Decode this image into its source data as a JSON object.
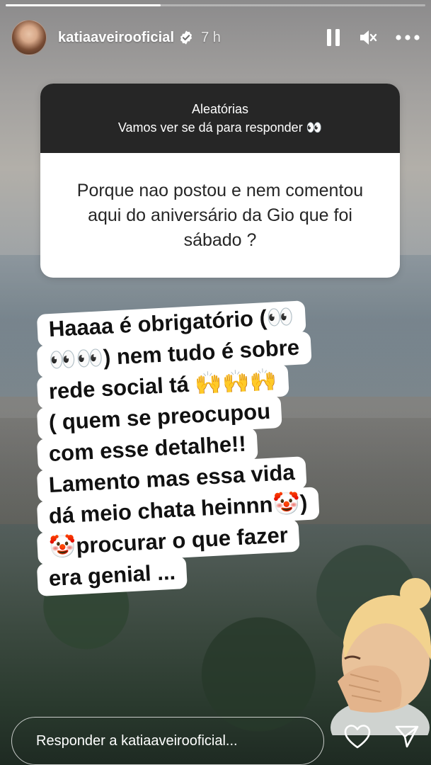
{
  "story": {
    "progress": 0.37,
    "progress_color": "#ffffff"
  },
  "header": {
    "username": "katiaaveirooficial",
    "time": "7 h",
    "icons": [
      "avatar",
      "verified-icon",
      "pause-icon",
      "mute-icon",
      "more-icon"
    ]
  },
  "question": {
    "title": "Aleatórias",
    "subtitle": "Vamos ver se dá para responder 👀",
    "text": "Porque nao postou e nem comentou aqui do aniversário da Gio que foi sábado ?",
    "header_color": "#262626"
  },
  "answer": {
    "lines": [
      "Haaaa é obrigatório (👀",
      "👀👀) nem tudo é sobre",
      "rede social tá 🙌🙌🙌",
      "( quem se preocupou",
      "com esse detalhe!!",
      "Lamento mas essa vida",
      "dá meio chata heinnn🤡)",
      "🤡procurar o que fazer",
      "era genial ..."
    ]
  },
  "footer": {
    "reply_placeholder": "Responder a katiaaveirooficial...",
    "icons": [
      "heart-icon",
      "send-icon"
    ]
  }
}
